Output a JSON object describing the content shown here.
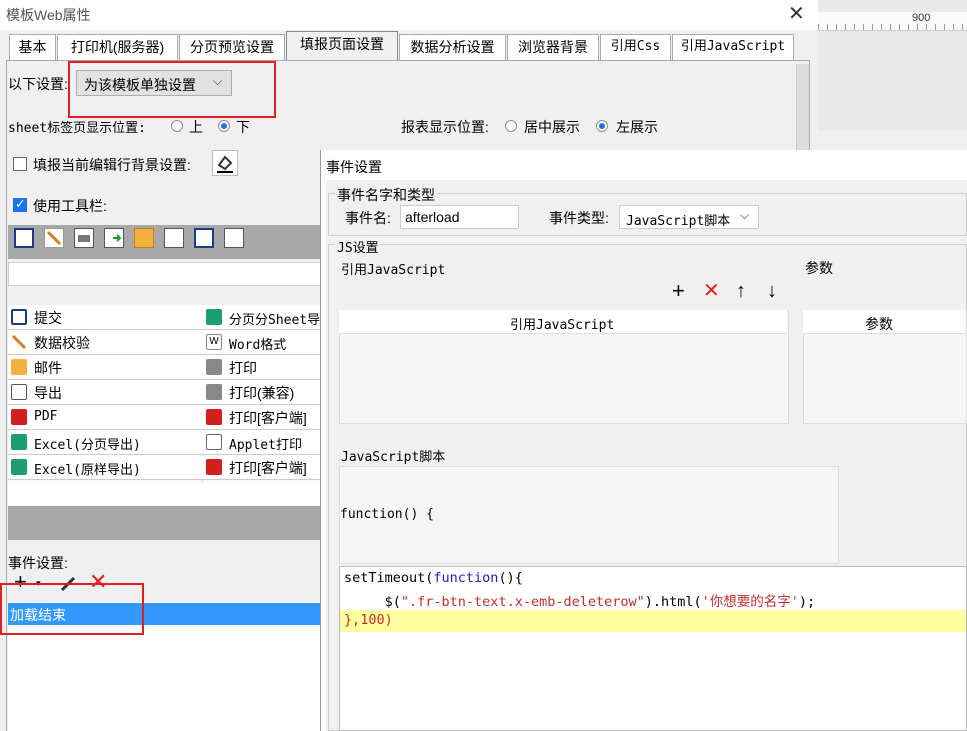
{
  "window": {
    "title": "模板Web属性",
    "close_glyph": "✕"
  },
  "ruler": {
    "mark": "900"
  },
  "tabs": [
    {
      "label": "基本",
      "active": false
    },
    {
      "label": "打印机(服务器)",
      "active": false
    },
    {
      "label": "分页预览设置",
      "active": false
    },
    {
      "label": "填报页面设置",
      "active": true
    },
    {
      "label": "数据分析设置",
      "active": false
    },
    {
      "label": "浏览器背景",
      "active": false
    },
    {
      "label": "引用Css",
      "active": false
    },
    {
      "label": "引用JavaScript",
      "active": false
    }
  ],
  "settings": {
    "scope_label": "以下设置:",
    "scope_value": "为该模板单独设置",
    "sheet_pos_label": "sheet标签页显示位置:",
    "sheet_pos_options": [
      "上",
      "下"
    ],
    "sheet_pos_selected": "下",
    "report_pos_label": "报表显示位置:",
    "report_pos_options": [
      "居中展示",
      "左展示"
    ],
    "report_pos_selected": "左展示",
    "row_bg_label": "填报当前编辑行背景设置:",
    "row_bg_checked": false,
    "toolbar_label": "使用工具栏:",
    "toolbar_checked": true
  },
  "buttons_left": [
    "提交",
    "数据校验",
    "邮件",
    "导出",
    "PDF",
    "Excel(分页导出)",
    "Excel(原样导出)"
  ],
  "buttons_right": [
    "分页分Sheet导",
    "Word格式",
    "打印",
    "打印(兼容)",
    "打印[客户端]",
    "Applet打印",
    "打印[客户端]"
  ],
  "events": {
    "label": "事件设置:",
    "items": [
      "加载结束"
    ]
  },
  "dialog": {
    "title": "事件设置",
    "section_name_type": "事件名字和类型",
    "event_name_label": "事件名:",
    "event_name_value": "afterload",
    "event_type_label": "事件类型:",
    "event_type_value": "JavaScript脚本",
    "section_js": "JS设置",
    "ref_js_label": "引用JavaScript",
    "params_label": "参数",
    "ref_js_col": "引用JavaScript",
    "params_col": "参数",
    "script_label": "JavaScript脚本",
    "func_header": "function() {",
    "code": {
      "line1_a": "setTimeout(",
      "line1_kw": "function",
      "line1_b": "(){",
      "line2_a": "     $(",
      "line2_str": "\".fr-btn-text.x-emb-deleterow\"",
      "line2_b": ").html(",
      "line2_str2": "'你想要的名字'",
      "line2_c": ");",
      "line3": "},100)"
    }
  },
  "colors": {
    "accent": "#1a73e8",
    "highlight": "#ffffa0",
    "red_box": "#e02020",
    "selected": "#3399ff"
  }
}
